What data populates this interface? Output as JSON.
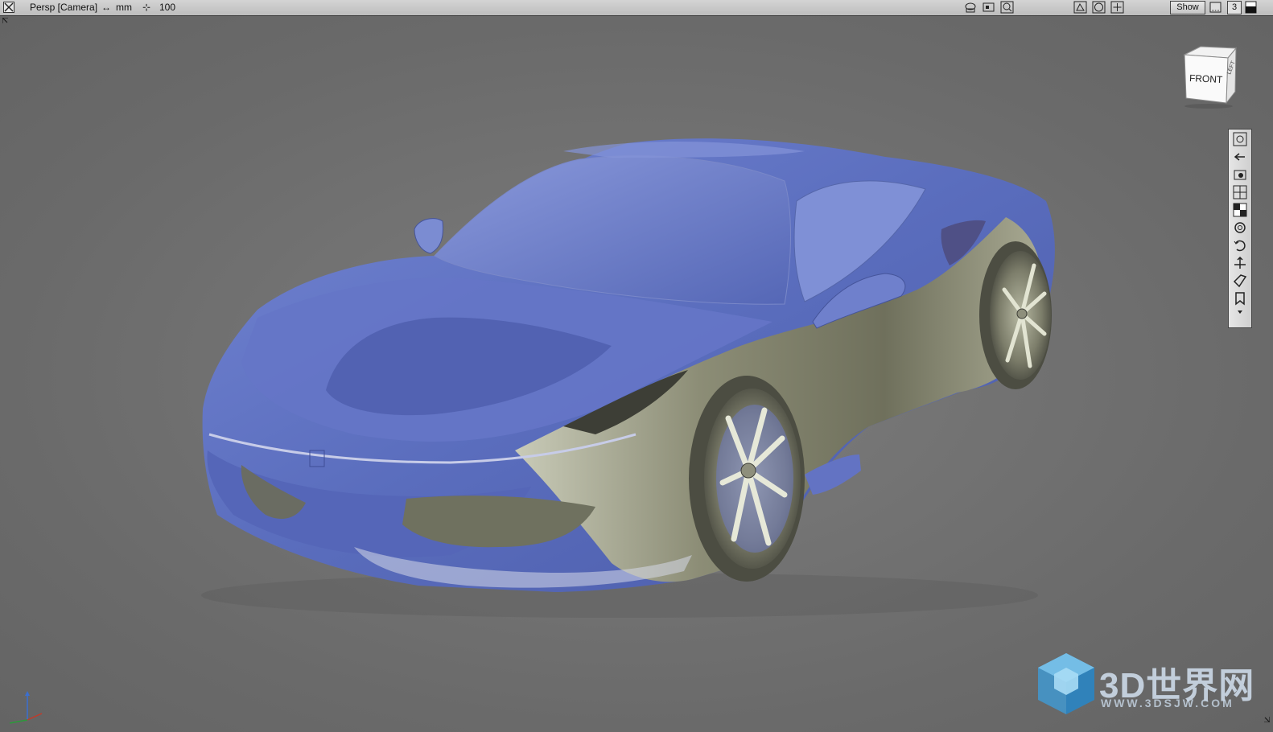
{
  "toolbar": {
    "view_label": "Persp [Camera]",
    "unit_label": "mm",
    "scale_value": "100",
    "show_label": "Show",
    "layer_number": "3"
  },
  "viewcube": {
    "front_label": "FRONT",
    "side_label": "LEFT"
  },
  "right_toolbar": {
    "icons": [
      "zoom-fit-icon",
      "back-arrow-icon",
      "camera-icon",
      "grid-icon",
      "checker-icon",
      "orbit-icon",
      "undo-rotate-icon",
      "pan-icon",
      "tag-icon",
      "bookmark-icon"
    ]
  },
  "watermark": {
    "title": "3D世界网",
    "url": "WWW.3DSJW.COM"
  },
  "colors": {
    "background": "#6b6b6b",
    "body_blue": "#5b6fbf",
    "body_silver": "#8f8f78",
    "watermark": "#4aa3d8"
  }
}
